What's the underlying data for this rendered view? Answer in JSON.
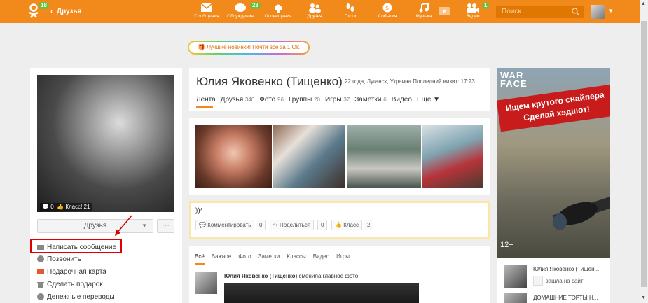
{
  "header": {
    "badge_logo": "18",
    "back_label": "Друзья",
    "nav": [
      {
        "label": "Сообщения",
        "icon": "envelope-icon",
        "badge": ""
      },
      {
        "label": "Обсуждения",
        "icon": "chat-icon",
        "badge": "28"
      },
      {
        "label": "Оповещения",
        "icon": "bell-icon",
        "badge": ""
      },
      {
        "label": "Друзья",
        "icon": "friends-icon",
        "badge": ""
      },
      {
        "label": "Гости",
        "icon": "footprints-icon",
        "badge": ""
      },
      {
        "label": "События",
        "icon": "events-icon",
        "badge": ""
      },
      {
        "label": "Музыка",
        "icon": "music-icon",
        "badge": ""
      },
      {
        "label": "Видео",
        "icon": "video-icon",
        "badge": "1"
      }
    ],
    "search_placeholder": "Поиск"
  },
  "promo": {
    "text": "Лучшие новинки! Почти все за 1 ОК"
  },
  "left": {
    "photo_comments": "0",
    "photo_likes": "Класс! 21",
    "friends_button": "Друзья",
    "more_button": "···",
    "actions": [
      {
        "label": "Написать сообщение",
        "icon": "envelope-icon"
      },
      {
        "label": "Позвонить",
        "icon": "phone-icon"
      },
      {
        "label": "Подарочная карта",
        "icon": "gift-card-icon"
      },
      {
        "label": "Сделать подарок",
        "icon": "gift-icon"
      },
      {
        "label": "Денежные переводы",
        "icon": "money-icon"
      }
    ]
  },
  "profile": {
    "name": "Юлия Яковенко (Тищенко)",
    "meta": "22 года, Луганск, Украина  Последний визит: 17:23",
    "tabs": [
      {
        "label": "Лента",
        "count": ""
      },
      {
        "label": "Друзья",
        "count": "340"
      },
      {
        "label": "Фото",
        "count": "96"
      },
      {
        "label": "Группы",
        "count": "20"
      },
      {
        "label": "Игры",
        "count": "37"
      },
      {
        "label": "Заметки",
        "count": "6"
      },
      {
        "label": "Видео",
        "count": ""
      },
      {
        "label": "Ещё ▼",
        "count": ""
      }
    ]
  },
  "status": {
    "text": "))*",
    "comment_label": "Комментировать",
    "comment_count": "0",
    "share_label": "Поделиться",
    "share_count": "0",
    "like_label": "Класс",
    "like_count": "2"
  },
  "feed": {
    "tabs": [
      "Всё",
      "Важное",
      "Фото",
      "Заметки",
      "Классы",
      "Видео",
      "Игры"
    ],
    "author": "Юлия Яковенко (Тищенко)",
    "action": "сменила главное фото"
  },
  "ad": {
    "logo_line1": "WAR",
    "logo_line2": "FACE",
    "line1": "Ищем крутого снайпера",
    "line2": "Сделай хэдшот!",
    "age": "12+"
  },
  "right_list": [
    {
      "name": "Юлия Яковенко (Тищен...",
      "visit": "зашла на сайт"
    },
    {
      "name": "ДОМАШНИЕ ТОРТЫ Н...",
      "visit": ""
    }
  ],
  "colors": {
    "accent": "#f28a1b",
    "highlight": "#e00000"
  }
}
